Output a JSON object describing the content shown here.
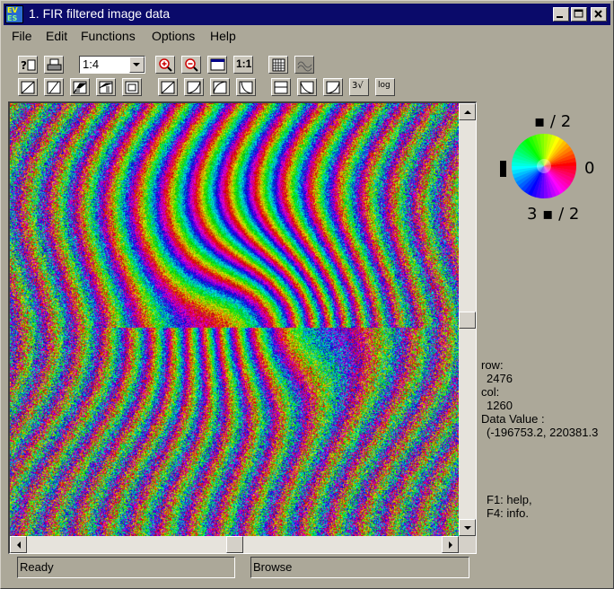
{
  "window": {
    "title": "1. FIR filtered image data",
    "icon_text_top": "EV",
    "icon_text_bottom": "ES"
  },
  "menu": [
    "File",
    "Edit",
    "Functions",
    "Options",
    "Help"
  ],
  "toolbar": {
    "zoom_value": "1:4",
    "zoom_reset_label": "1:1",
    "log_label": "log",
    "cube_root_label": "3√"
  },
  "phase_wheel": {
    "top_label": "▪ / 2",
    "right_label": "0",
    "bottom_label": "3 ▪ / 2"
  },
  "info": {
    "row_label": "row:",
    "row_value": "2476",
    "col_label": "col:",
    "col_value": "1260",
    "data_label": "Data Value :",
    "data_value": "(-196753.2, 220381.3"
  },
  "help": {
    "line1": "F1: help,",
    "line2": "F4: info."
  },
  "status": {
    "left": "Ready",
    "right": "Browse"
  },
  "colors": {
    "title_bar": "#0a0a6a",
    "window_bg": "#aca899"
  },
  "scroll": {
    "vertical_position": 0.5,
    "horizontal_position": 0.5
  }
}
